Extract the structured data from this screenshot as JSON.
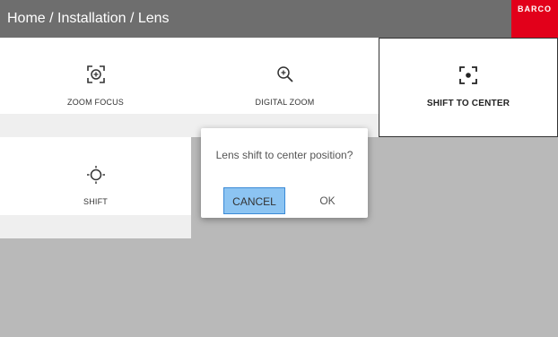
{
  "header": {
    "breadcrumb": "Home / Installation / Lens",
    "brand": "BARCO",
    "brand_color": "#e2001a"
  },
  "tiles": [
    {
      "label": "ZOOM FOCUS",
      "icon": "zoom-focus-icon"
    },
    {
      "label": "DIGITAL ZOOM",
      "icon": "digital-zoom-icon"
    },
    {
      "label": "SHIFT TO CENTER",
      "icon": "shift-to-center-icon",
      "selected": true
    },
    {
      "label": "SHIFT",
      "icon": "shift-icon"
    }
  ],
  "dialog": {
    "message": "Lens shift to center position?",
    "cancel_label": "CANCEL",
    "ok_label": "OK"
  }
}
